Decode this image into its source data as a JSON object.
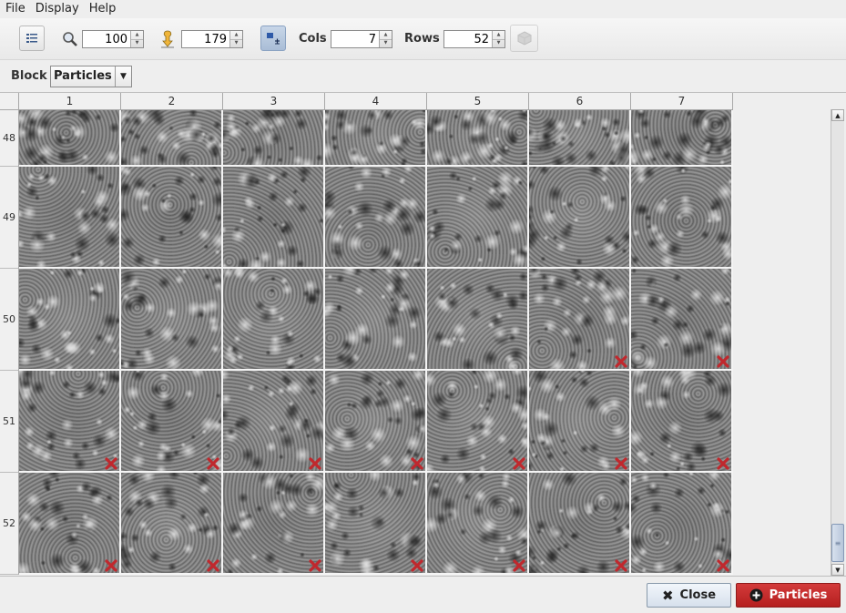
{
  "menu": [
    "File",
    "Display",
    "Help"
  ],
  "toolbar": {
    "zoom_value": "100",
    "angle_value": "179",
    "cols_label": "Cols",
    "cols_value": "7",
    "rows_label": "Rows",
    "rows_value": "52"
  },
  "block": {
    "label": "Block",
    "selected": "Particles"
  },
  "columns": [
    "1",
    "2",
    "3",
    "4",
    "5",
    "6",
    "7"
  ],
  "rows": [
    {
      "label": "48",
      "disabled": [
        false,
        false,
        false,
        false,
        false,
        false,
        false
      ]
    },
    {
      "label": "49",
      "disabled": [
        false,
        false,
        false,
        false,
        false,
        false,
        false
      ]
    },
    {
      "label": "50",
      "disabled": [
        false,
        false,
        false,
        false,
        false,
        true,
        true
      ]
    },
    {
      "label": "51",
      "disabled": [
        true,
        true,
        true,
        true,
        true,
        true,
        true
      ]
    },
    {
      "label": "52",
      "disabled": [
        true,
        true,
        true,
        true,
        true,
        true,
        true
      ]
    }
  ],
  "footer": {
    "close_label": "Close",
    "particles_label": "Particles"
  },
  "colors": {
    "accent_red": "#c0282d",
    "selected_toggle": "#a9bdd6"
  }
}
